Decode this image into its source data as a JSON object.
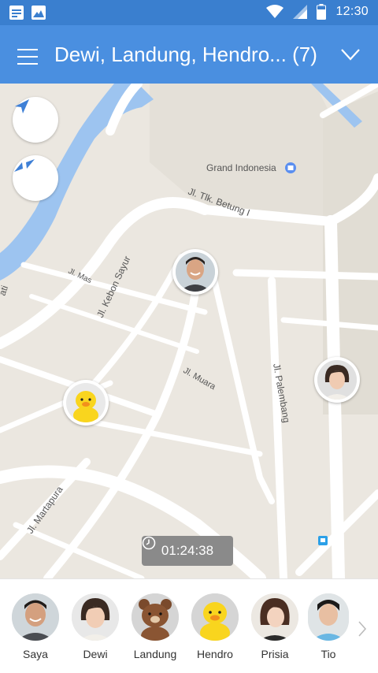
{
  "status_bar": {
    "time": "12:30"
  },
  "app_bar": {
    "title": "Dewi, Landung, Hendro... (7)"
  },
  "map": {
    "place_label": "Grand Indonesia",
    "streets": [
      "Jl. Tlk. Betung I",
      "Jl. Mas",
      "Jl. Kebon Sayur",
      "Jl. Muara",
      "Jl. Palembang",
      "Jl. Martapura",
      "ati"
    ],
    "timer": "01:24:38"
  },
  "friends": [
    {
      "name": "Saya"
    },
    {
      "name": "Dewi"
    },
    {
      "name": "Landung"
    },
    {
      "name": "Hendro"
    },
    {
      "name": "Prisia"
    },
    {
      "name": "Tio"
    }
  ],
  "colors": {
    "status_bar": "#3a7fcf",
    "app_bar": "#4a8fe0",
    "map_background": "#ebe7e0",
    "water": "#9dc4f0",
    "roads": "#ffffff",
    "timer_bg": "#8a8a8a"
  },
  "icons": [
    "notes-icon",
    "image-icon",
    "wifi-icon",
    "signal-icon",
    "battery-icon",
    "menu-icon",
    "chevron-down-icon",
    "navigation-arrow-icon",
    "converge-icon",
    "clock-icon",
    "chevron-right-icon"
  ]
}
